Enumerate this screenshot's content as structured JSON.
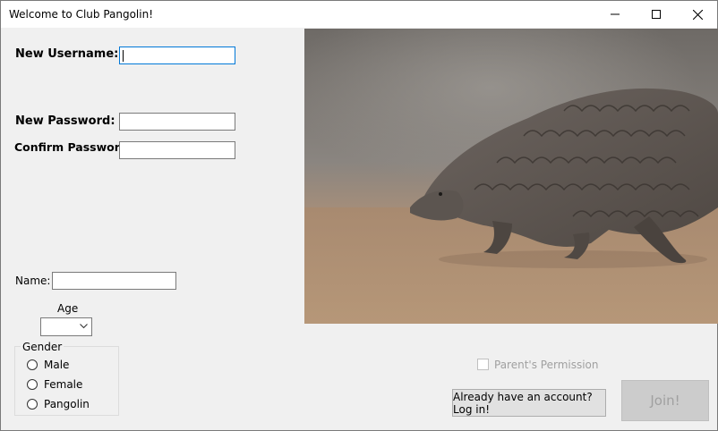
{
  "window": {
    "title": "Welcome to Club Pangolin!",
    "controls": [
      "minimize-icon",
      "maximize-icon",
      "close-icon"
    ]
  },
  "form": {
    "username_label": "New Username:",
    "username_value": "",
    "password_label": "New Password:",
    "password_value": "",
    "confirm_label": "Confirm Password:",
    "confirm_value": "",
    "name_label": "Name:",
    "name_value": "",
    "age_label": "Age",
    "age_value": ""
  },
  "gender": {
    "title": "Gender",
    "options": [
      "Male",
      "Female",
      "Pangolin"
    ]
  },
  "parent_permission": {
    "label": "Parent's Permission",
    "checked": false
  },
  "buttons": {
    "login_label": "Already have an account? Log in!",
    "join_label": "Join!"
  },
  "colors": {
    "focus_border": "#0078d7",
    "disabled_text": "#a0a0a0"
  }
}
